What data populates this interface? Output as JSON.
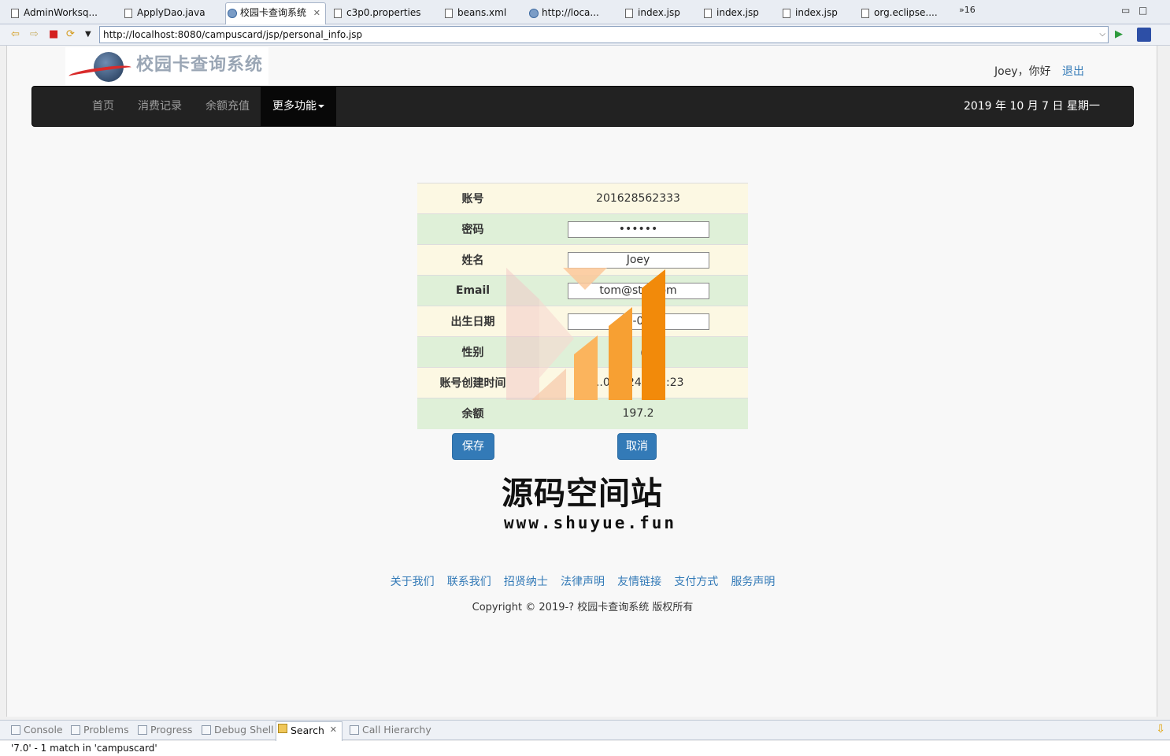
{
  "editor_tabs": [
    {
      "label": "AdminWorksq...",
      "icon": "java-file-icon"
    },
    {
      "label": "ApplyDao.java",
      "icon": "java-file-icon"
    },
    {
      "label": "校园卡查询系统",
      "icon": "globe-icon"
    },
    {
      "label": "c3p0.properties",
      "icon": "properties-file-icon"
    },
    {
      "label": "beans.xml",
      "icon": "xml-file-icon"
    },
    {
      "label": "http://loca...",
      "icon": "globe-icon"
    },
    {
      "label": "index.jsp",
      "icon": "jsp-file-icon"
    },
    {
      "label": "index.jsp",
      "icon": "jsp-file-icon"
    },
    {
      "label": "index.jsp",
      "icon": "jsp-file-icon"
    },
    {
      "label": "org.eclipse....",
      "icon": "xml-file-icon"
    }
  ],
  "overflow_count": "»16",
  "browser": {
    "url": "http://localhost:8080/campuscard/jsp/personal_info.jsp"
  },
  "site": {
    "logo_text": "校园卡查询系统",
    "greeting": "Joey，你好",
    "logout": "退出"
  },
  "nav": {
    "items": [
      "首页",
      "消费记录",
      "余额充值",
      "更多功能"
    ],
    "date": "2019 年 10 月 7 日 星期一"
  },
  "profile": {
    "account_label": "账号",
    "account_value": "201628562333",
    "password_label": "密码",
    "password_value": "••••••",
    "name_label": "姓名",
    "name_value": "Joey",
    "email_label": "Email",
    "email_value": "tom@sto...om",
    "birth_label": "出生日期",
    "birth_value": "...7-0...4",
    "gender_label": "性别",
    "gender_value": "女",
    "created_label": "账号创建时间",
    "created_value": "...01...24...57:23",
    "balance_label": "余额",
    "balance_value": "197.2"
  },
  "buttons": {
    "save": "保存",
    "second": "取消"
  },
  "watermark": {
    "text": "源码空间站",
    "url": "www.shuyue.fun"
  },
  "footer": {
    "links": [
      "关于我们",
      "联系我们",
      "招贤纳士",
      "法律声明",
      "友情链接",
      "支付方式",
      "服务声明"
    ],
    "copyright": "Copyright © 2019-? 校园卡查询系统 版权所有"
  },
  "views": [
    {
      "label": "Console"
    },
    {
      "label": "Problems"
    },
    {
      "label": "Progress"
    },
    {
      "label": "Debug Shell"
    },
    {
      "label": "Search"
    },
    {
      "label": "Call Hierarchy"
    }
  ],
  "status_text": "'7.0' - 1 match in 'campuscard'",
  "colors": {
    "nav_bg": "#222222",
    "link": "#337ab7",
    "row_yellow": "#fcf8e3",
    "row_green": "#dff0d8",
    "watermark_orange": "#f28a0a"
  }
}
